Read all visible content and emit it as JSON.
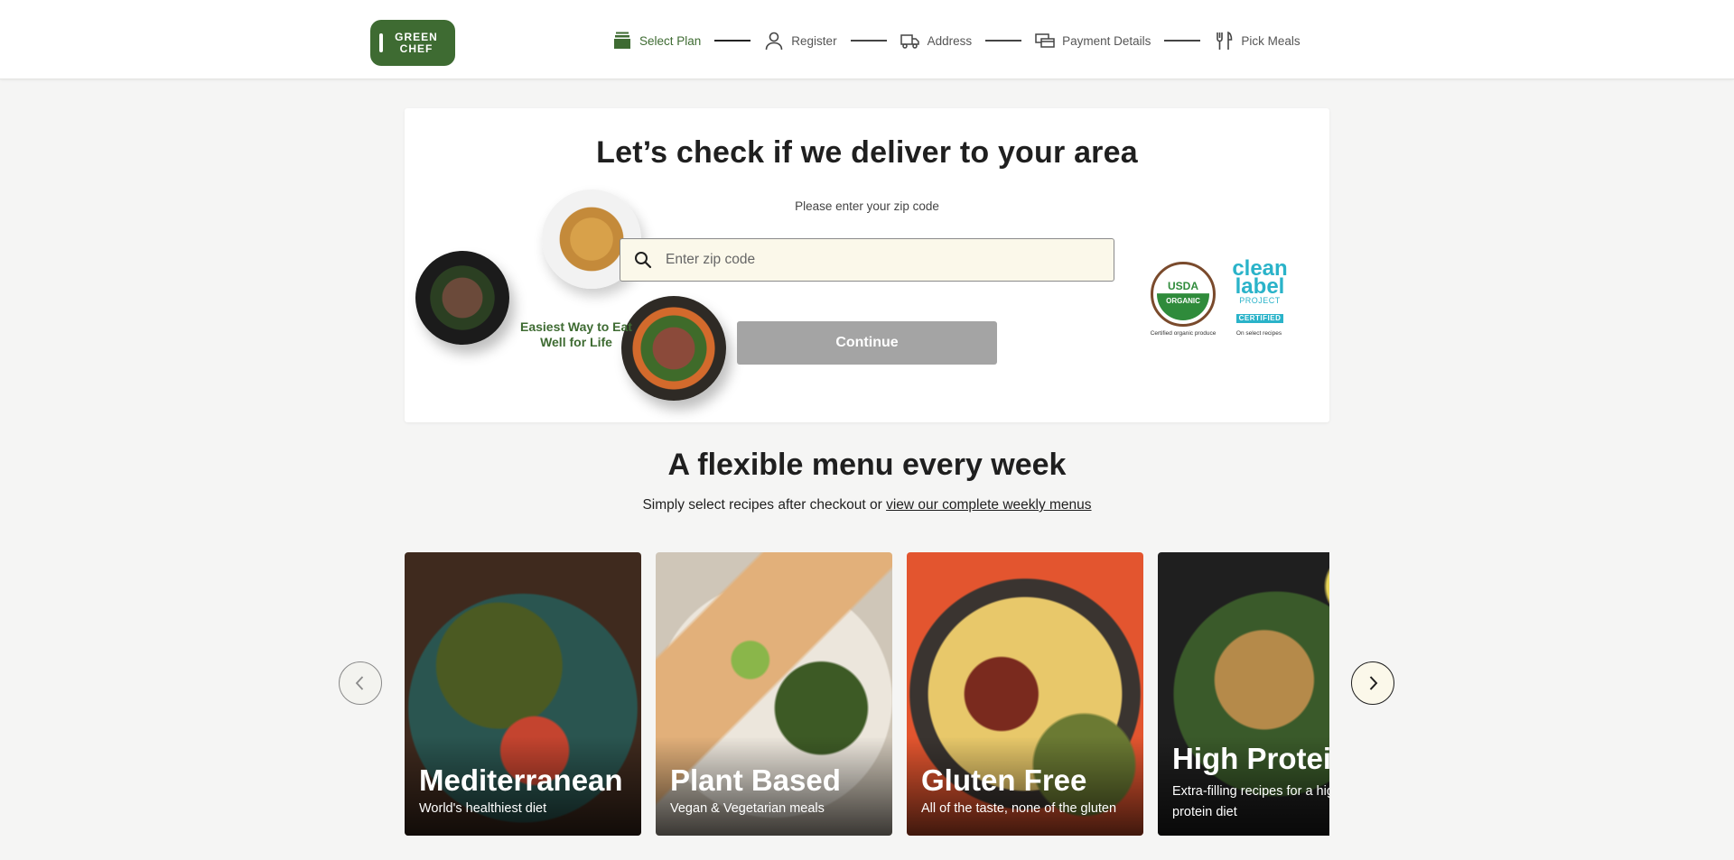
{
  "logo": {
    "line1": "GREEN",
    "line2": "CHEF"
  },
  "stepper": {
    "steps": [
      {
        "label": "Select Plan",
        "icon": "box-icon",
        "active": true
      },
      {
        "label": "Register",
        "icon": "user-icon",
        "active": false
      },
      {
        "label": "Address",
        "icon": "truck-icon",
        "active": false
      },
      {
        "label": "Payment Details",
        "icon": "card-icon",
        "active": false
      },
      {
        "label": "Pick Meals",
        "icon": "fork-knife-icon",
        "active": false
      }
    ]
  },
  "delivery": {
    "title": "Let’s check if we deliver to your area",
    "zip_label": "Please enter your zip code",
    "zip_placeholder": "Enter zip code",
    "zip_value": "",
    "continue_label": "Continue",
    "tagline": "Easiest Way to Eat Well for Life",
    "usda": {
      "top": "USDA",
      "bottom": "ORGANIC",
      "caption": "Certified organic produce"
    },
    "clean_label": {
      "line1": "clean",
      "line2": "label",
      "line3": "PROJECT",
      "line4": "CERTIFIED",
      "caption": "On select recipes"
    }
  },
  "menu": {
    "title": "A flexible menu every week",
    "subtitle_prefix": "Simply select recipes after checkout or ",
    "subtitle_link": "view our complete weekly menus",
    "cards": [
      {
        "name": "Mediterranean",
        "desc": "World's healthiest diet"
      },
      {
        "name": "Plant Based",
        "desc": "Vegan & Vegetarian meals"
      },
      {
        "name": "Gluten Free",
        "desc": "All of the taste, none of the gluten"
      },
      {
        "name": "High Protein",
        "desc": "Extra-filling recipes for a high protein diet"
      }
    ]
  },
  "colors": {
    "brand": "#3e6b32",
    "zip_bg": "#fbf8ea",
    "disabled_button": "#a4a4a4",
    "clean_label": "#2ab3c9"
  }
}
